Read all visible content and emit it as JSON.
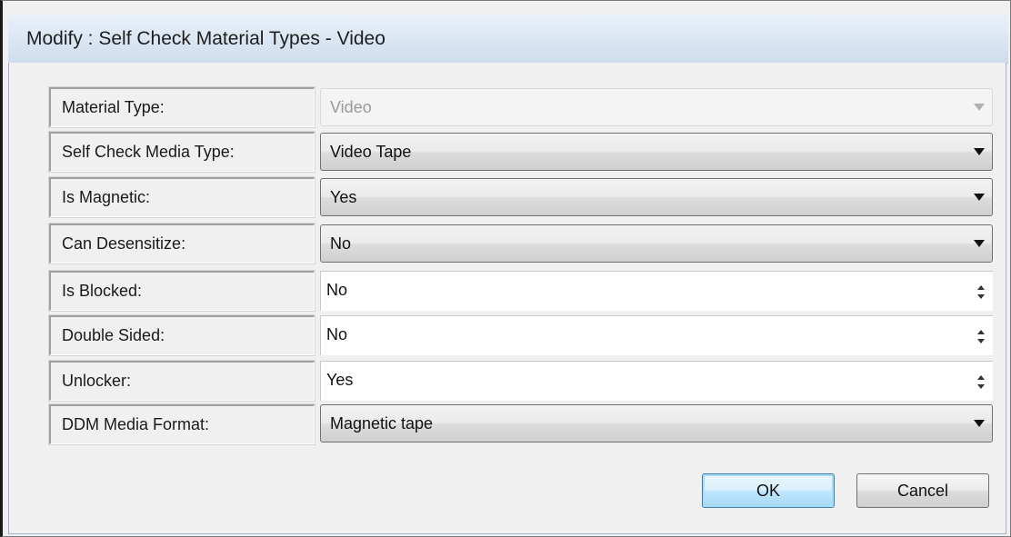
{
  "dialog": {
    "title": "Modify :  Self Check Material Types - Video"
  },
  "fields": {
    "material_type": {
      "label": "Material Type:",
      "value": "Video",
      "enabled": false
    },
    "self_check_media_type": {
      "label": "Self Check Media Type:",
      "value": "Video Tape"
    },
    "is_magnetic": {
      "label": "Is Magnetic:",
      "value": "Yes"
    },
    "can_desensitize": {
      "label": "Can Desensitize:",
      "value": "No"
    },
    "is_blocked": {
      "label": "Is Blocked:",
      "value": "No"
    },
    "double_sided": {
      "label": "Double Sided:",
      "value": "No"
    },
    "unlocker": {
      "label": "Unlocker:",
      "value": "Yes"
    },
    "ddm_media_format": {
      "label": "DDM Media Format:",
      "value": "Magnetic tape"
    }
  },
  "buttons": {
    "ok": "OK",
    "cancel": "Cancel"
  },
  "colors": {
    "title_bar": "#dbe6f3",
    "dialog_bg": "#f0f0f0",
    "default_button_border": "#3c7fb1"
  }
}
